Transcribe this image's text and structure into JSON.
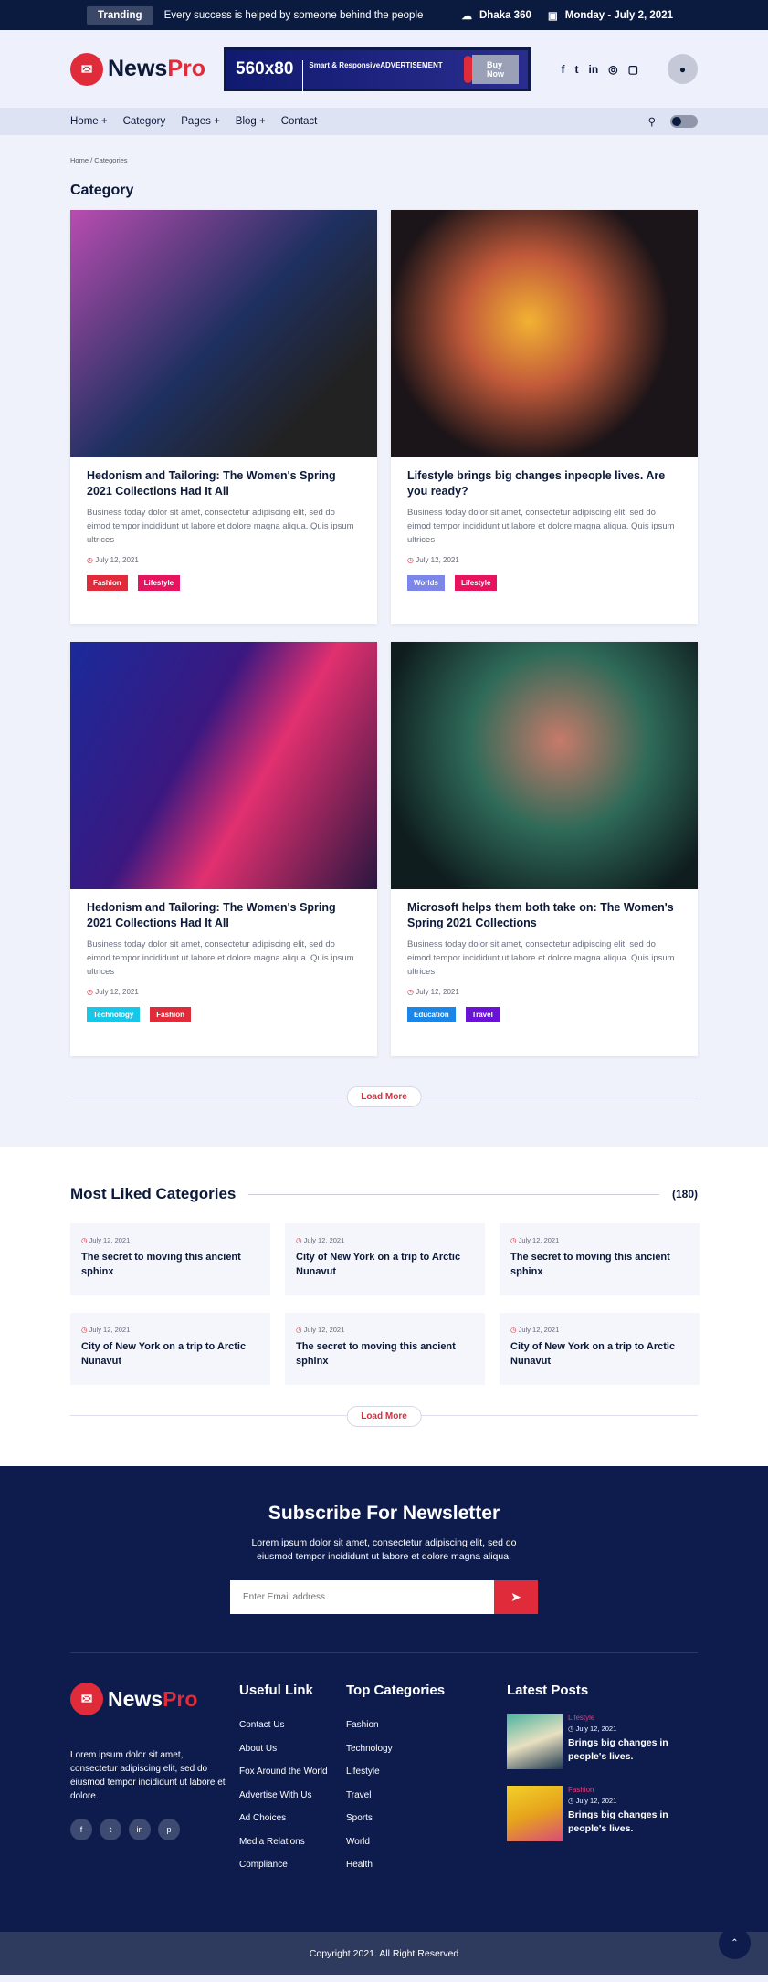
{
  "topbar": {
    "badge": "Tranding",
    "headline": "Every success is helped by someone behind the people",
    "weather": "Dhaka 360",
    "date": "Monday - July 2, 2021"
  },
  "header": {
    "logo_a": "News",
    "logo_b": "Pro",
    "ad_size": "560x80",
    "ad_line1": "Smart & Responsive",
    "ad_line2": "ADVERTISEMENT",
    "ad_button": "Buy Now"
  },
  "nav": {
    "items": [
      "Home +",
      "Category",
      "Pages +",
      "Blog +",
      "Contact"
    ]
  },
  "breadcrumb": "Home / Categories",
  "section_title": "Category",
  "cards": [
    {
      "title": "Hedonism and Tailoring: The Women's Spring 2021 Collections Had It All",
      "excerpt": "Business today dolor sit amet, consectetur adipiscing elit, sed do eimod tempor incididunt ut labore et dolore magna aliqua. Quis ipsum ultrices",
      "date": "July 12, 2021",
      "tags": [
        {
          "label": "Fashion",
          "color": "#e02b3a"
        },
        {
          "label": "Lifestyle",
          "color": "#e6135f"
        }
      ],
      "bg": "linear-gradient(135deg,#b84db0,#1e3060 50%,#222 80%)"
    },
    {
      "title": "Lifestyle brings big changes inpeople lives. Are you ready?",
      "excerpt": "Business today dolor sit amet, consectetur adipiscing elit, sed do eimod tempor incididunt ut labore et dolore magna aliqua. Quis ipsum ultrices",
      "date": "July 12, 2021",
      "tags": [
        {
          "label": "Worlds",
          "color": "#7b86e8"
        },
        {
          "label": "Lifestyle",
          "color": "#e6135f"
        }
      ],
      "bg": "radial-gradient(circle at 45% 45%,#f2b233,#c25a3a 30%,#1b1418 65%)"
    },
    {
      "title": "Hedonism and Tailoring: The Women's Spring 2021 Collections Had It All",
      "excerpt": "Business today dolor sit amet, consectetur adipiscing elit, sed do eimod tempor incididunt ut labore et dolore magna aliqua. Quis ipsum ultrices",
      "date": "July 12, 2021",
      "tags": [
        {
          "label": "Technology",
          "color": "#16c7e8"
        },
        {
          "label": "Fashion",
          "color": "#e02b3a"
        }
      ],
      "bg": "linear-gradient(120deg,#1a2a9a,#3b1880 40%,#e23070 60%,#2a1640)"
    },
    {
      "title": "Microsoft helps them both take on: The Women's Spring 2021 Collections",
      "excerpt": "Business today dolor sit amet, consectetur adipiscing elit, sed do eimod tempor incididunt ut labore et dolore magna aliqua. Quis ipsum ultrices",
      "date": "July 12, 2021",
      "tags": [
        {
          "label": "Education",
          "color": "#1a86e8"
        },
        {
          "label": "Travel",
          "color": "#6a13d6"
        }
      ],
      "bg": "radial-gradient(circle at 55% 40%,#c77a6a,#2f6a58 40%,#0f1d1f 80%)"
    }
  ],
  "load_more": "Load More",
  "liked": {
    "title": "Most Liked Categories",
    "count": "(180)",
    "items": [
      {
        "date": "July 12, 2021",
        "title": "The secret to moving this ancient sphinx"
      },
      {
        "date": "July 12, 2021",
        "title": "City of New York on a trip to Arctic Nunavut"
      },
      {
        "date": "July 12, 2021",
        "title": "The secret to moving this ancient sphinx"
      },
      {
        "date": "July 12, 2021",
        "title": "City of New York on a trip to Arctic Nunavut"
      },
      {
        "date": "July 12, 2021",
        "title": "The secret to moving this ancient sphinx"
      },
      {
        "date": "July 12, 2021",
        "title": "City of New York on a trip to Arctic Nunavut"
      }
    ]
  },
  "newsletter": {
    "title": "Subscribe For Newsletter",
    "text": "Lorem ipsum dolor sit amet, consectetur adipiscing elit, sed do eiusmod tempor incididunt ut labore et dolore magna aliqua.",
    "placeholder": "Enter Email address"
  },
  "footer": {
    "about": "Lorem ipsum dolor sit amet, consectetur adipiscing elit, sed do eiusmod tempor incididunt ut labore et dolore.",
    "useful_title": "Useful Link",
    "useful": [
      "Contact Us",
      "About Us",
      "Fox Around the World",
      "Advertise With Us",
      "Ad Choices",
      "Media Relations",
      "Compliance"
    ],
    "cat_title": "Top Categories",
    "cats": [
      "Fashion",
      "Technology",
      "Lifestyle",
      "Travel",
      "Sports",
      "World",
      "Health"
    ],
    "posts_title": "Latest Posts",
    "posts": [
      {
        "cat": "Lifestyle",
        "date": "July 12, 2021",
        "title": "Brings big changes in people's lives."
      },
      {
        "cat": "Fashion",
        "date": "July 12, 2021",
        "title": "Brings big changes in people's lives."
      }
    ],
    "copyright": "Copyright 2021. All Right Reserved"
  }
}
